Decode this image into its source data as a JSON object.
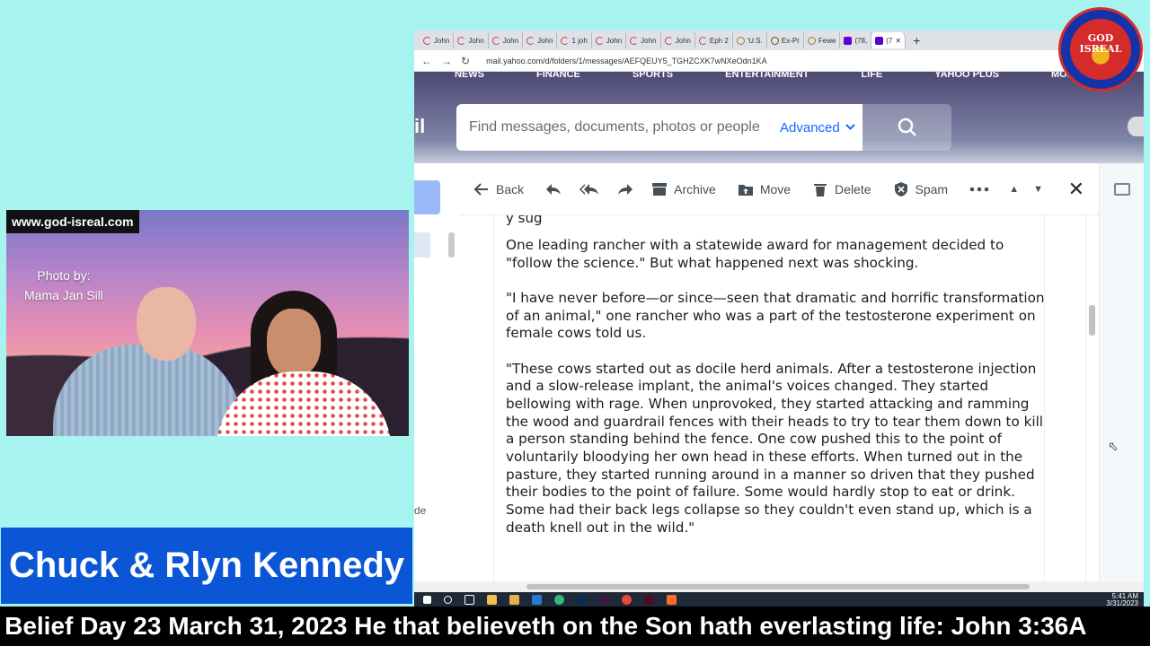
{
  "overlay": {
    "website": "www.god-isreal.com",
    "photo_credit_line1": "Photo by:",
    "photo_credit_line2": "Mama Jan Sill",
    "name_banner": "Chuck & Rlyn Kennedy",
    "ticker": "f Belief Day 23 March 31, 2023 He that believeth on the Son hath everlasting life: John 3:36A",
    "logo_text_line1": "GOD",
    "logo_text_line2": "ISREAL"
  },
  "browser": {
    "tabs": [
      {
        "label": "John"
      },
      {
        "label": "John"
      },
      {
        "label": "John"
      },
      {
        "label": "John"
      },
      {
        "label": "1 joh"
      },
      {
        "label": "John"
      },
      {
        "label": "John"
      },
      {
        "label": "John"
      },
      {
        "label": "Eph 2"
      },
      {
        "label": "'U.S."
      },
      {
        "label": "Ex-Pr"
      },
      {
        "label": "Fewe"
      },
      {
        "label": "(78,"
      },
      {
        "label": "(7"
      }
    ],
    "url": "mail.yahoo.com/d/folders/1/messages/AEFQEUY5_TGHZCXK7wNXeOdn1KA"
  },
  "yahoo": {
    "nav": [
      "NEWS",
      "FINANCE",
      "SPORTS",
      "ENTERTAINMENT",
      "LIFE",
      "YAHOO PLUS",
      "MORE..."
    ],
    "logo_fragment": "il",
    "search_placeholder": "Find messages, documents, photos or people",
    "advanced_label": "Advanced",
    "left_rail_text": "de"
  },
  "toolbar": {
    "back": "Back",
    "archive": "Archive",
    "move": "Move",
    "delete": "Delete",
    "spam": "Spam"
  },
  "message": {
    "top_cut": "y sug",
    "paragraphs": [
      "One leading rancher with a statewide award for management decided to \"follow the science.\" But what happened next was shocking.",
      "\"I have never before—or since—seen that dramatic and horrific transformation of an animal,\" one rancher who was a part of the testosterone experiment on female cows told us.",
      "\"These cows started out as docile herd animals. After a testosterone injection and a slow-release implant, the animal's voices changed. They started bellowing with rage. When unprovoked, they started attacking and ramming the wood and guardrail fences with their heads to try to tear them down to kill a person standing behind the fence. One cow pushed this to the point of voluntarily bloodying her own head in these efforts. When turned out in the pasture, they started running around in a manner so driven that they pushed their bodies to the point of failure. Some would hardly stop to eat or drink. Some had their back legs collapse so they couldn't even stand up, which is a death knell out in the wild.\""
    ]
  },
  "taskbar": {
    "time": "5:41 AM",
    "date": "3/31/2023"
  },
  "colors": {
    "background": "#a7f3ef",
    "banner": "#0b56d6",
    "yahoo_accent": "#0f69ff"
  }
}
